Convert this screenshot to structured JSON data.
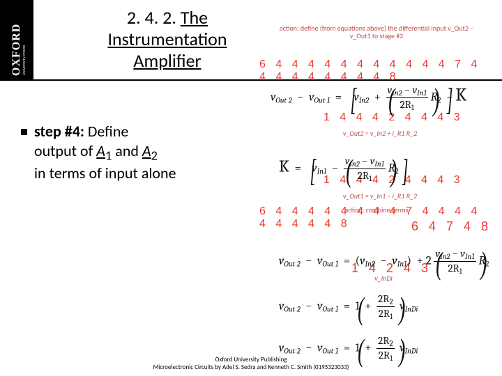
{
  "title": {
    "num": "2. 4. 2. ",
    "word": "The Instrumentation Amplifier"
  },
  "body": {
    "lead": "step #4:",
    "rest_line1": " Define",
    "rest_line2": "output of ",
    "A1": "A",
    "A1sub": "1",
    "and": " and ",
    "A2": "A",
    "A2sub": "2",
    "rest_line3": "in terms of input alone"
  },
  "footer": {
    "l1": "Oxford University Publishing",
    "l2": "Microelectronic Circuits by Adel S. Sedra and Kenneth C. Smith (0195323033)"
  },
  "annot": {
    "top": "action: define (from equations above) the differential input v_Out2 – v_Out1 to stage #2",
    "r2": "v_Out2 = v_In2 + i_R1 R_2",
    "r3": "v_Out1 = v_In1 − i_R1 R_2",
    "r4": "action: combine terms",
    "r5": "v_InDi"
  },
  "digits": {
    "d1": "6 4 4 4 4 4 4 4 4 4 4 4 7 4 4 4 4 4 4 4 4 4 8",
    "d2": "1 4 4 4 2 4 4 4 3",
    "d3": "1 4 4 4 2 4 4 4 3",
    "d4": "6 4 4 4 4 4 4 4 4 7 4 4 4 4 4 4 4 4 4 8",
    "d5": "6 4 7 4 8",
    "d6": "1 4 2 4 3"
  },
  "eq": {
    "vOut2": "v",
    "vOut2s": "Out 2",
    "vOut1": "v",
    "vOut1s": "Out 1",
    "vIn1": "v",
    "vIn1s": "In1",
    "vIn2": "v",
    "vIn2s": "In2",
    "vInDi": "v",
    "vInDis": "InDi",
    "R2": "R",
    "R2s": "2",
    "R1": "R",
    "R1s": "1",
    "twoR1": "2R",
    "twoR2": "2R",
    "K": "K",
    "minus": "−",
    "plus": "+",
    "eq": "=",
    "one": "1",
    "two": "2"
  }
}
